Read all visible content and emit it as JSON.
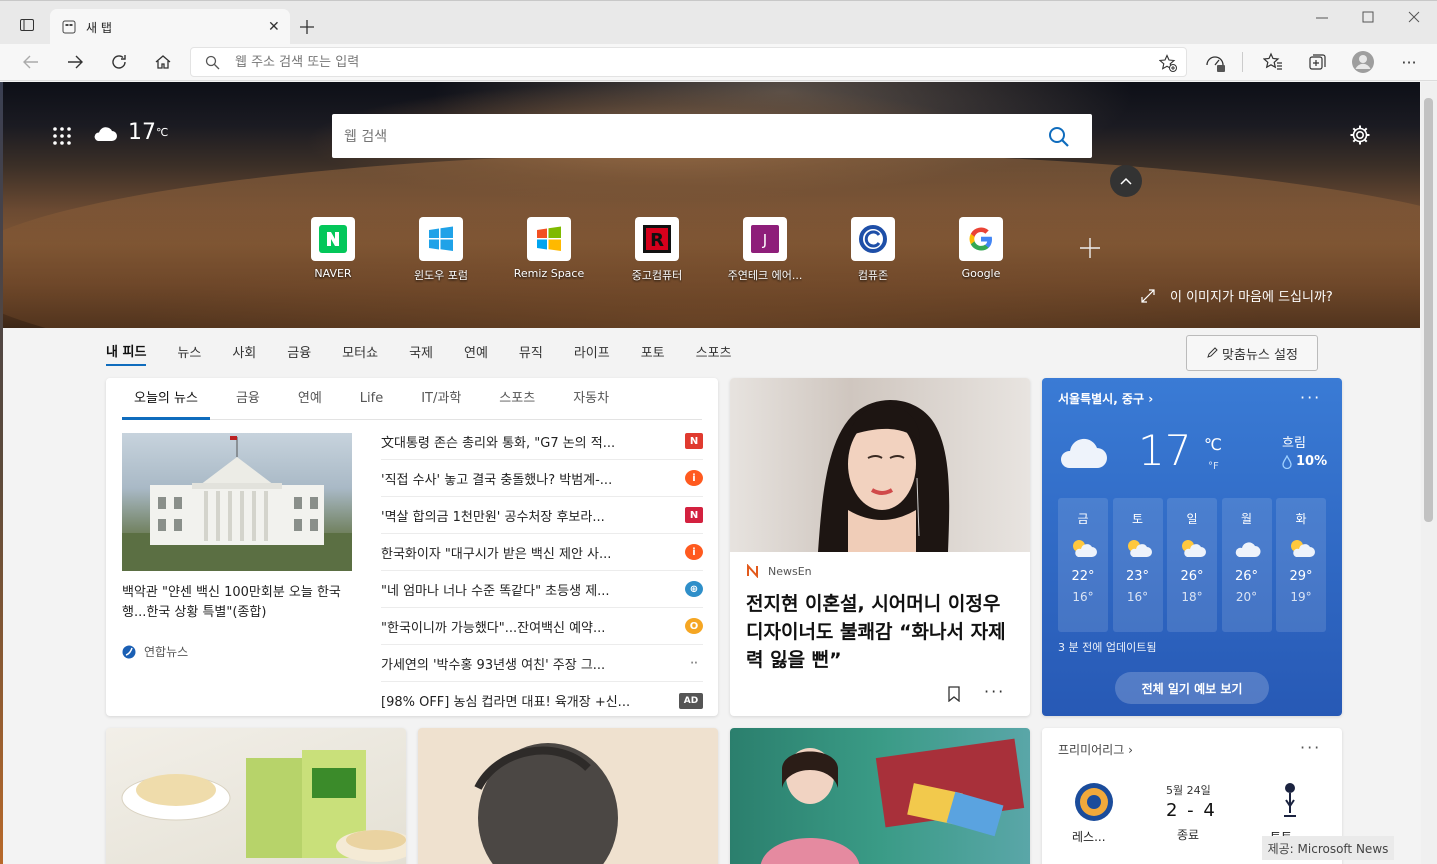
{
  "browser": {
    "tab_title": "새 탭",
    "address_placeholder": "웹 주소 검색 또는 입력"
  },
  "hero": {
    "temperature": "17",
    "temp_unit": "℃",
    "search_placeholder": "웹 검색",
    "like_image": "이 이미지가 마음에 드십니까?",
    "quick_links": [
      {
        "label": "NAVER",
        "letter": "N",
        "color": "#03c75a"
      },
      {
        "label": "윈도우 포럼",
        "letter": "",
        "color": "#1fa2e8"
      },
      {
        "label": "Remiz Space",
        "letter": "",
        "color": "#f25022"
      },
      {
        "label": "중고컴퓨터",
        "letter": "R",
        "color": "#d6001c"
      },
      {
        "label": "주연테크 에어...",
        "letter": "J",
        "color": "#8e1e7a"
      },
      {
        "label": "컴퓨존",
        "letter": "C",
        "color": "#1e4fa8"
      },
      {
        "label": "Google",
        "letter": "G",
        "color": "#4285f4"
      }
    ]
  },
  "feed_nav": [
    "내 피드",
    "뉴스",
    "사회",
    "금융",
    "모터쇼",
    "국제",
    "연예",
    "뮤직",
    "라이프",
    "포토",
    "스포츠"
  ],
  "customize_label": "맞춤뉴스 설정",
  "news": {
    "tabs": [
      "오늘의 뉴스",
      "금융",
      "연예",
      "Life",
      "IT/과학",
      "스포츠",
      "자동차"
    ],
    "lead_title": "백악관 \"얀센 백신 100만회분 오늘 한국행...한국 상황 특별\"(종합)",
    "lead_source": "연합뉴스",
    "headlines": [
      {
        "text": "文대통령 존슨 총리와 통화, \"G7 논의 적...",
        "logo": "N",
        "color": "#e03a2f"
      },
      {
        "text": "'직접 수사' 놓고 결국 충돌했나? 박범계-...",
        "logo": "i",
        "color": "#ff5a1f"
      },
      {
        "text": "'멱살 합의금 1천만원' 공수처장 후보라...",
        "logo": "N",
        "color": "#d3213f"
      },
      {
        "text": "한국화이자 \"대구시가 받은 백신 제안 사...",
        "logo": "i",
        "color": "#ff5a1f"
      },
      {
        "text": "\"네 엄마나 너나 수준 똑같다\" 초등생 제...",
        "logo": "⊕",
        "color": "#2f8fc9"
      },
      {
        "text": "\"한국이니까 가능했다\"...잔여백신 예약...",
        "logo": "O",
        "color": "#f5a623"
      },
      {
        "text": "가세연의 '박수홍 93년생 여친' 주장 그...",
        "logo": "··",
        "color": "#888888"
      },
      {
        "text": "[98% OFF] 농심 컵라면 대표! 육개장 +신...",
        "logo": "AD",
        "color": "#555555"
      }
    ]
  },
  "celeb": {
    "source": "NewsEn",
    "title": "전지현 이혼설, 시어머니 이정우 디자이너도 불쾌감 “화나서 자제력 잃을 뻔”"
  },
  "weather": {
    "location": "서울특별시, 중구",
    "temp": "17",
    "unit_c": "℃",
    "unit_f": "°F",
    "condition": "흐림",
    "rain": "10%",
    "days": [
      {
        "day": "금",
        "hi": "22°",
        "lo": "16°"
      },
      {
        "day": "토",
        "hi": "23°",
        "lo": "16°"
      },
      {
        "day": "일",
        "hi": "26°",
        "lo": "18°"
      },
      {
        "day": "월",
        "hi": "26°",
        "lo": "20°"
      },
      {
        "day": "화",
        "hi": "29°",
        "lo": "19°"
      }
    ],
    "updated": "3 분 전에 업데이트됨",
    "button": "전체 일기 예보 보기"
  },
  "league": {
    "name": "프리미어리그",
    "date": "5월 24일",
    "score": "2 - 4",
    "status": "종료",
    "home": "레스...",
    "away": "토트..."
  },
  "footer": "제공: Microsoft News"
}
